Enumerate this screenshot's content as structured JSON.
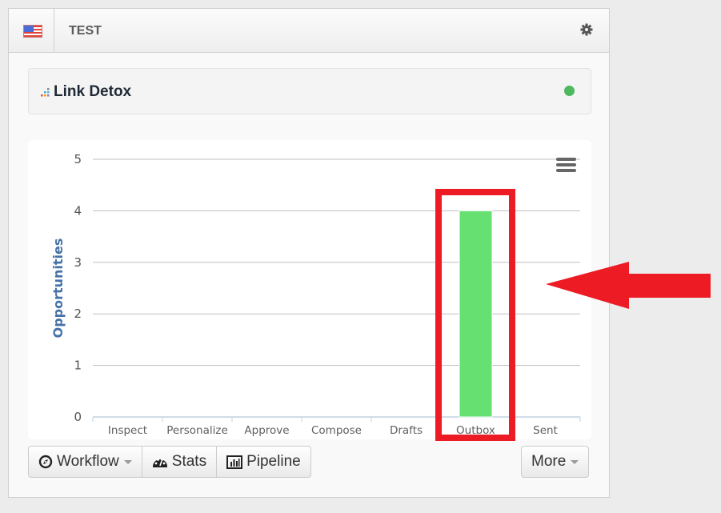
{
  "header": {
    "flag_icon": "us-flag-icon",
    "title": "TEST",
    "settings_icon": "gear-icon"
  },
  "brand": {
    "name": "Link Detox",
    "status": "online",
    "status_color": "#4db85f"
  },
  "chart_data": {
    "type": "bar",
    "title": "",
    "xlabel": "",
    "ylabel": "Opportunities",
    "categories": [
      "Inspect",
      "Personalize",
      "Approve",
      "Compose",
      "Drafts",
      "Outbox",
      "Sent"
    ],
    "values": [
      0,
      0,
      0,
      0,
      0,
      4,
      0
    ],
    "ylim": [
      0,
      5
    ],
    "yticks": [
      0,
      1,
      2,
      3,
      4,
      5
    ],
    "grid": true,
    "bar_color": "#66e070",
    "menu_icon": "hamburger-menu-icon"
  },
  "toolbar": {
    "workflow_label": "Workflow",
    "stats_label": "Stats",
    "pipeline_label": "Pipeline",
    "more_label": "More"
  },
  "annotations": {
    "highlight_target": "Outbox",
    "color": "#ed1c24"
  }
}
